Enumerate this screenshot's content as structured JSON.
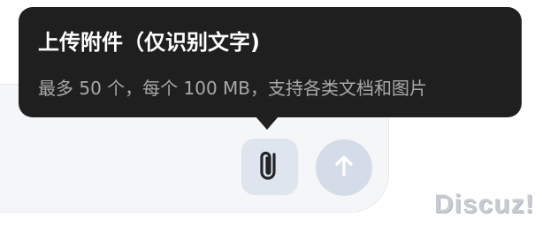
{
  "tooltip": {
    "title": "上传附件（仅识别文字)",
    "subtitle": "最多 50 个，每个 100 MB，支持各类文档和图片"
  },
  "composer": {
    "attach_icon": "paperclip-icon",
    "send_icon": "arrow-up-icon",
    "colors": {
      "panel": "#f5f6f8",
      "attach_button": "#dfe5ee",
      "send_button": "#d4dce7",
      "icon_dark": "#232428",
      "icon_light": "#ffffff"
    }
  },
  "watermark": {
    "text": "Discuz!"
  }
}
